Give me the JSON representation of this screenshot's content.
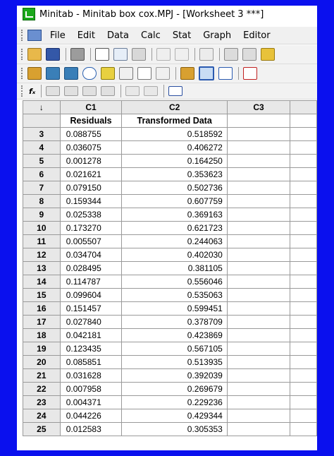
{
  "window": {
    "title": "Minitab - Minitab box cox.MPJ - [Worksheet 3 ***]"
  },
  "menu": [
    "File",
    "Edit",
    "Data",
    "Calc",
    "Stat",
    "Graph",
    "Editor"
  ],
  "toolbar": {
    "formula_label": "fₓ"
  },
  "worksheet": {
    "corner": "↓",
    "columns": [
      "C1",
      "C2",
      "C3"
    ],
    "names": [
      "Residuals",
      "Transformed Data",
      ""
    ],
    "rows": [
      {
        "n": "3",
        "c1": "0.088755",
        "c2": "0.518592"
      },
      {
        "n": "4",
        "c1": "0.036075",
        "c2": "0.406272"
      },
      {
        "n": "5",
        "c1": "0.001278",
        "c2": "0.164250"
      },
      {
        "n": "6",
        "c1": "0.021621",
        "c2": "0.353623"
      },
      {
        "n": "7",
        "c1": "0.079150",
        "c2": "0.502736"
      },
      {
        "n": "8",
        "c1": "0.159344",
        "c2": "0.607759"
      },
      {
        "n": "9",
        "c1": "0.025338",
        "c2": "0.369163"
      },
      {
        "n": "10",
        "c1": "0.173270",
        "c2": "0.621723"
      },
      {
        "n": "11",
        "c1": "0.005507",
        "c2": "0.244063"
      },
      {
        "n": "12",
        "c1": "0.034704",
        "c2": "0.402030"
      },
      {
        "n": "13",
        "c1": "0.028495",
        "c2": "0.381105"
      },
      {
        "n": "14",
        "c1": "0.114787",
        "c2": "0.556046"
      },
      {
        "n": "15",
        "c1": "0.099604",
        "c2": "0.535063"
      },
      {
        "n": "16",
        "c1": "0.151457",
        "c2": "0.599451"
      },
      {
        "n": "17",
        "c1": "0.027840",
        "c2": "0.378709"
      },
      {
        "n": "18",
        "c1": "0.042181",
        "c2": "0.423869"
      },
      {
        "n": "19",
        "c1": "0.123435",
        "c2": "0.567105"
      },
      {
        "n": "20",
        "c1": "0.085851",
        "c2": "0.513935"
      },
      {
        "n": "21",
        "c1": "0.031628",
        "c2": "0.392039"
      },
      {
        "n": "22",
        "c1": "0.007958",
        "c2": "0.269679"
      },
      {
        "n": "23",
        "c1": "0.004371",
        "c2": "0.229236"
      },
      {
        "n": "24",
        "c1": "0.044226",
        "c2": "0.429344"
      },
      {
        "n": "25",
        "c1": "0.012583",
        "c2": "0.305353"
      }
    ]
  },
  "colors": {
    "background": "#0a10ee",
    "header_gray": "#e8e8e8",
    "grid_line": "#9a9a9a"
  }
}
